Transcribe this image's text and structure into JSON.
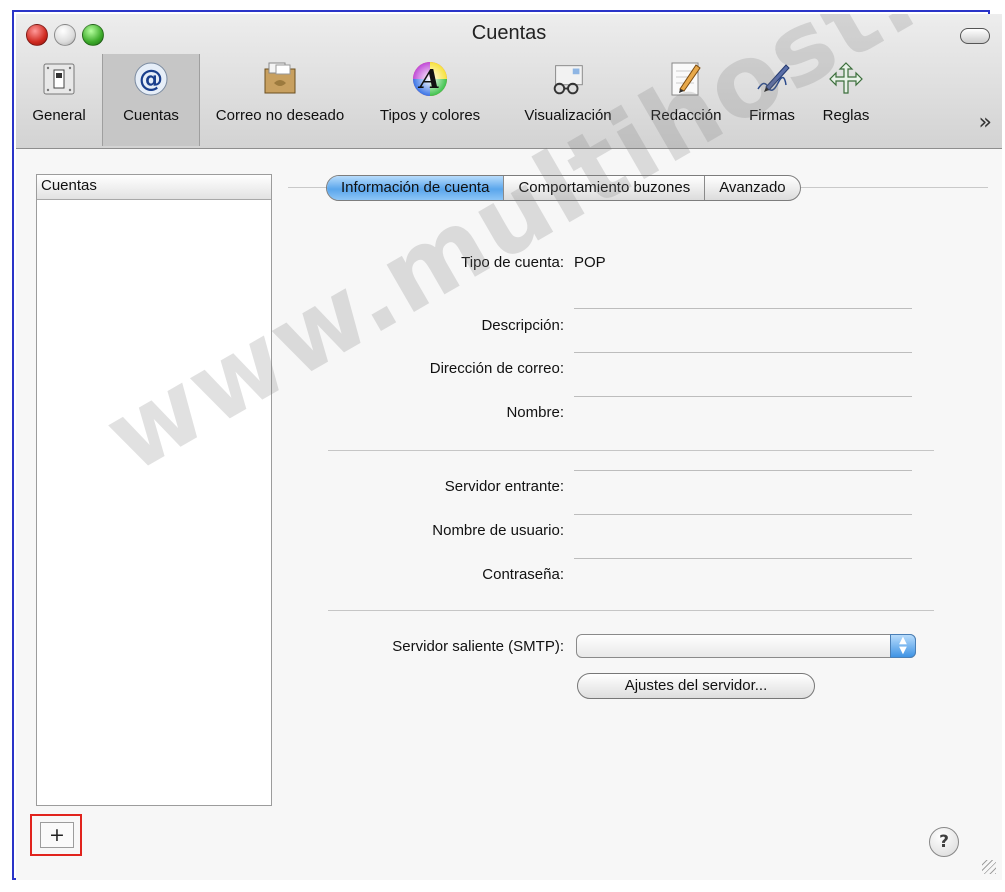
{
  "window": {
    "title": "Cuentas"
  },
  "toolbar": {
    "items": [
      {
        "label": "General",
        "icon": "general-switch-icon"
      },
      {
        "label": "Cuentas",
        "icon": "at-sign-icon",
        "selected": true
      },
      {
        "label": "Correo no deseado",
        "icon": "junk-mail-icon"
      },
      {
        "label": "Tipos y colores",
        "icon": "fonts-colors-icon"
      },
      {
        "label": "Visualización",
        "icon": "viewing-glasses-icon"
      },
      {
        "label": "Redacción",
        "icon": "composing-pencil-icon"
      },
      {
        "label": "Firmas",
        "icon": "signature-pen-icon"
      },
      {
        "label": "Reglas",
        "icon": "rules-icon"
      }
    ],
    "overflow_label": "»"
  },
  "sidebar": {
    "header": "Cuentas",
    "add_button": "+"
  },
  "tabs": [
    {
      "label": "Información de cuenta",
      "active": true
    },
    {
      "label": "Comportamiento buzones",
      "active": false
    },
    {
      "label": "Avanzado",
      "active": false
    }
  ],
  "form": {
    "account_type_label": "Tipo de cuenta:",
    "account_type_value": "POP",
    "description_label": "Descripción:",
    "email_label": "Dirección de correo:",
    "name_label": "Nombre:",
    "incoming_label": "Servidor entrante:",
    "username_label": "Nombre de usuario:",
    "password_label": "Contraseña:",
    "smtp_label": "Servidor saliente (SMTP):",
    "server_settings_button": "Ajustes del servidor..."
  },
  "help_button": "?",
  "watermark": "www.multihost.cl",
  "colors": {
    "frame_border": "#2a34c8",
    "highlight": "#e1231d",
    "selected_tab": "#5aa6ec"
  }
}
